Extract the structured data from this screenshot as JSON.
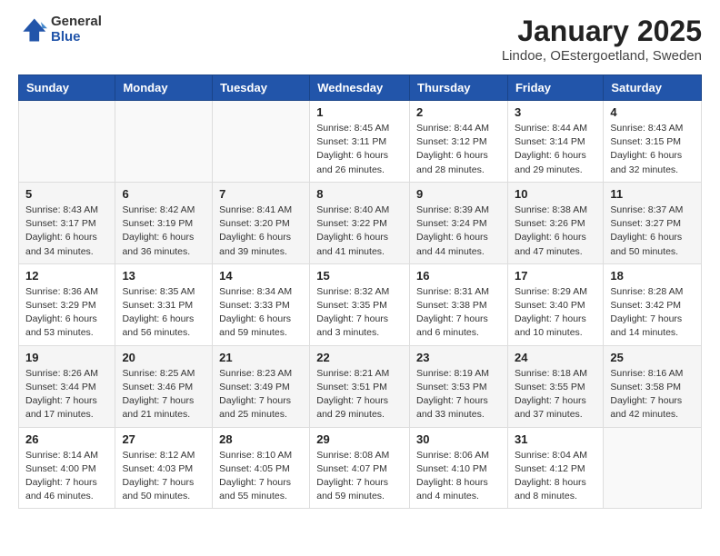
{
  "logo": {
    "general": "General",
    "blue": "Blue"
  },
  "title": "January 2025",
  "subtitle": "Lindoe, OEstergoetland, Sweden",
  "days_of_week": [
    "Sunday",
    "Monday",
    "Tuesday",
    "Wednesday",
    "Thursday",
    "Friday",
    "Saturday"
  ],
  "weeks": [
    [
      {
        "day": "",
        "info": ""
      },
      {
        "day": "",
        "info": ""
      },
      {
        "day": "",
        "info": ""
      },
      {
        "day": "1",
        "info": "Sunrise: 8:45 AM\nSunset: 3:11 PM\nDaylight: 6 hours\nand 26 minutes."
      },
      {
        "day": "2",
        "info": "Sunrise: 8:44 AM\nSunset: 3:12 PM\nDaylight: 6 hours\nand 28 minutes."
      },
      {
        "day": "3",
        "info": "Sunrise: 8:44 AM\nSunset: 3:14 PM\nDaylight: 6 hours\nand 29 minutes."
      },
      {
        "day": "4",
        "info": "Sunrise: 8:43 AM\nSunset: 3:15 PM\nDaylight: 6 hours\nand 32 minutes."
      }
    ],
    [
      {
        "day": "5",
        "info": "Sunrise: 8:43 AM\nSunset: 3:17 PM\nDaylight: 6 hours\nand 34 minutes."
      },
      {
        "day": "6",
        "info": "Sunrise: 8:42 AM\nSunset: 3:19 PM\nDaylight: 6 hours\nand 36 minutes."
      },
      {
        "day": "7",
        "info": "Sunrise: 8:41 AM\nSunset: 3:20 PM\nDaylight: 6 hours\nand 39 minutes."
      },
      {
        "day": "8",
        "info": "Sunrise: 8:40 AM\nSunset: 3:22 PM\nDaylight: 6 hours\nand 41 minutes."
      },
      {
        "day": "9",
        "info": "Sunrise: 8:39 AM\nSunset: 3:24 PM\nDaylight: 6 hours\nand 44 minutes."
      },
      {
        "day": "10",
        "info": "Sunrise: 8:38 AM\nSunset: 3:26 PM\nDaylight: 6 hours\nand 47 minutes."
      },
      {
        "day": "11",
        "info": "Sunrise: 8:37 AM\nSunset: 3:27 PM\nDaylight: 6 hours\nand 50 minutes."
      }
    ],
    [
      {
        "day": "12",
        "info": "Sunrise: 8:36 AM\nSunset: 3:29 PM\nDaylight: 6 hours\nand 53 minutes."
      },
      {
        "day": "13",
        "info": "Sunrise: 8:35 AM\nSunset: 3:31 PM\nDaylight: 6 hours\nand 56 minutes."
      },
      {
        "day": "14",
        "info": "Sunrise: 8:34 AM\nSunset: 3:33 PM\nDaylight: 6 hours\nand 59 minutes."
      },
      {
        "day": "15",
        "info": "Sunrise: 8:32 AM\nSunset: 3:35 PM\nDaylight: 7 hours\nand 3 minutes."
      },
      {
        "day": "16",
        "info": "Sunrise: 8:31 AM\nSunset: 3:38 PM\nDaylight: 7 hours\nand 6 minutes."
      },
      {
        "day": "17",
        "info": "Sunrise: 8:29 AM\nSunset: 3:40 PM\nDaylight: 7 hours\nand 10 minutes."
      },
      {
        "day": "18",
        "info": "Sunrise: 8:28 AM\nSunset: 3:42 PM\nDaylight: 7 hours\nand 14 minutes."
      }
    ],
    [
      {
        "day": "19",
        "info": "Sunrise: 8:26 AM\nSunset: 3:44 PM\nDaylight: 7 hours\nand 17 minutes."
      },
      {
        "day": "20",
        "info": "Sunrise: 8:25 AM\nSunset: 3:46 PM\nDaylight: 7 hours\nand 21 minutes."
      },
      {
        "day": "21",
        "info": "Sunrise: 8:23 AM\nSunset: 3:49 PM\nDaylight: 7 hours\nand 25 minutes."
      },
      {
        "day": "22",
        "info": "Sunrise: 8:21 AM\nSunset: 3:51 PM\nDaylight: 7 hours\nand 29 minutes."
      },
      {
        "day": "23",
        "info": "Sunrise: 8:19 AM\nSunset: 3:53 PM\nDaylight: 7 hours\nand 33 minutes."
      },
      {
        "day": "24",
        "info": "Sunrise: 8:18 AM\nSunset: 3:55 PM\nDaylight: 7 hours\nand 37 minutes."
      },
      {
        "day": "25",
        "info": "Sunrise: 8:16 AM\nSunset: 3:58 PM\nDaylight: 7 hours\nand 42 minutes."
      }
    ],
    [
      {
        "day": "26",
        "info": "Sunrise: 8:14 AM\nSunset: 4:00 PM\nDaylight: 7 hours\nand 46 minutes."
      },
      {
        "day": "27",
        "info": "Sunrise: 8:12 AM\nSunset: 4:03 PM\nDaylight: 7 hours\nand 50 minutes."
      },
      {
        "day": "28",
        "info": "Sunrise: 8:10 AM\nSunset: 4:05 PM\nDaylight: 7 hours\nand 55 minutes."
      },
      {
        "day": "29",
        "info": "Sunrise: 8:08 AM\nSunset: 4:07 PM\nDaylight: 7 hours\nand 59 minutes."
      },
      {
        "day": "30",
        "info": "Sunrise: 8:06 AM\nSunset: 4:10 PM\nDaylight: 8 hours\nand 4 minutes."
      },
      {
        "day": "31",
        "info": "Sunrise: 8:04 AM\nSunset: 4:12 PM\nDaylight: 8 hours\nand 8 minutes."
      },
      {
        "day": "",
        "info": ""
      }
    ]
  ]
}
